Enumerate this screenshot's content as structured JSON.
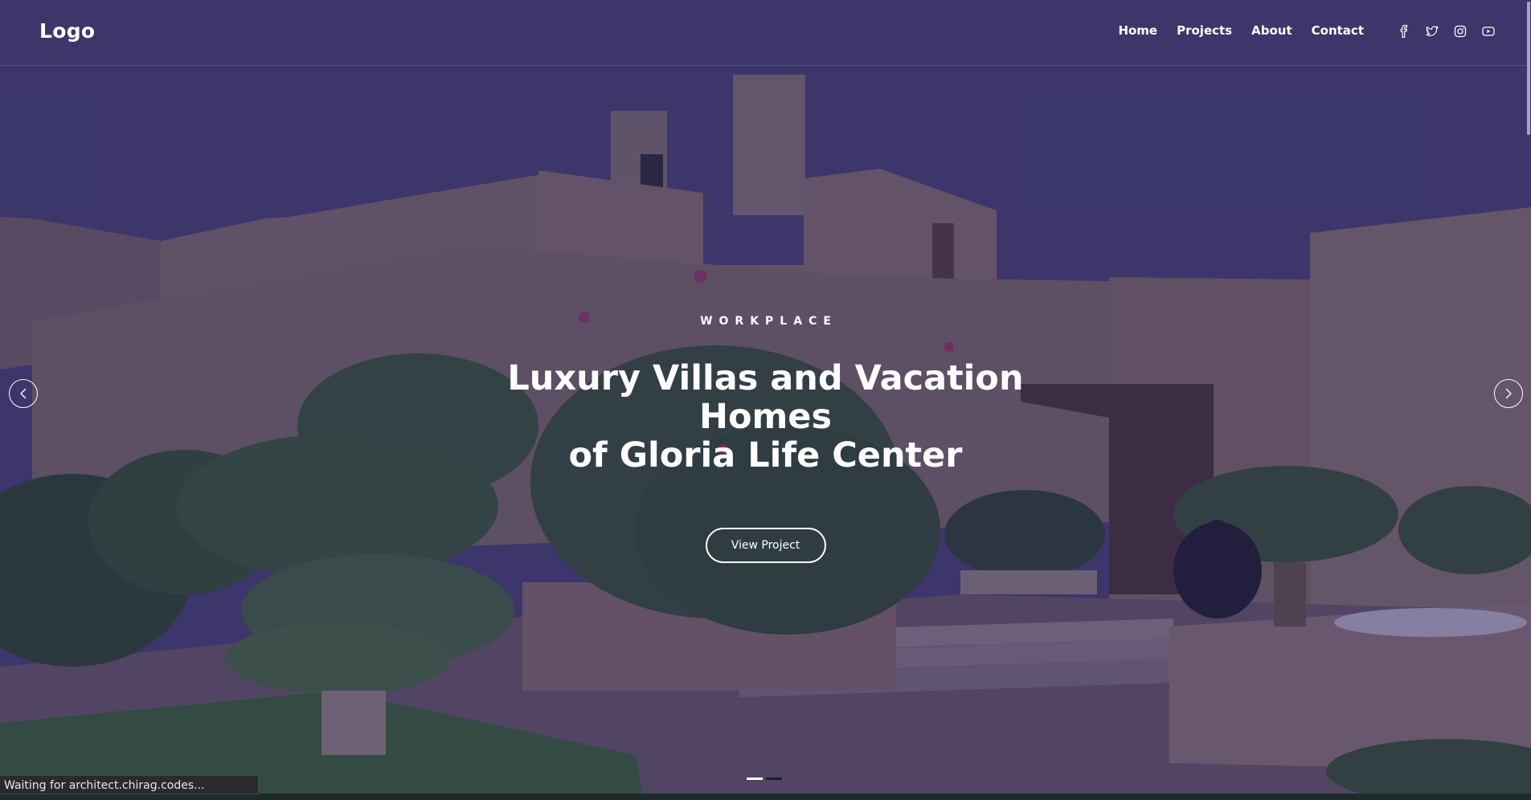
{
  "header": {
    "logo": "Logo",
    "nav": [
      "Home",
      "Projects",
      "About",
      "Contact"
    ],
    "social_icons": [
      "facebook-icon",
      "twitter-icon",
      "instagram-icon",
      "youtube-icon"
    ]
  },
  "hero": {
    "eyebrow": "WORKPLACE",
    "title_line1": "Luxury Villas and Vacation Homes",
    "title_line2": "of Gloria Life Center",
    "cta_label": "View Project"
  },
  "slider": {
    "slide_count": 2,
    "active_index": 0,
    "prev_icon": "chevron-left-icon",
    "next_icon": "chevron-right-icon"
  },
  "status_bar": {
    "text": "Waiting for architect.chirag.codes..."
  },
  "colors": {
    "overlay": "#28225a",
    "text": "#ffffff",
    "status_bg": "#2a2a2e"
  }
}
